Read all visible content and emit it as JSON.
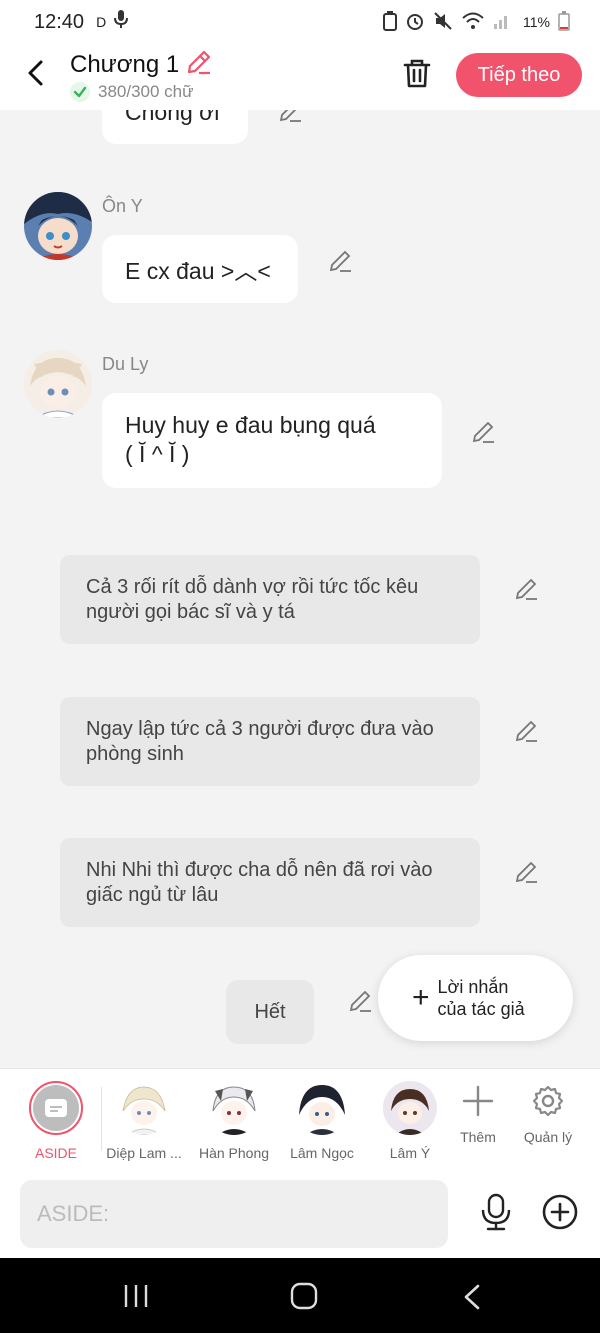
{
  "status_bar": {
    "time": "12:40",
    "d_label": "D",
    "battery": "11%"
  },
  "header": {
    "title": "Chương 1",
    "word_count": "380/300 chữ",
    "next_label": "Tiếp theo"
  },
  "messages": [
    {
      "name": "",
      "text": "Chồng ơi"
    },
    {
      "name": "Ôn Y",
      "text": "E cx đau >︿<"
    },
    {
      "name": "Du Ly",
      "line1": "Huy huy e đau bụng quá",
      "line2": "( Ĭ ^ Ĭ )"
    }
  ],
  "narrations": [
    {
      "line1": "Cả 3 rối rít dỗ dành vợ rồi tức tốc kêu",
      "line2": "người gọi bác sĩ và y tá"
    },
    {
      "line1": "Ngay lập tức cả 3 người được đưa vào",
      "line2": "phòng sinh"
    },
    {
      "line1": "Nhi Nhi thì được cha dỗ nên đã rơi vào",
      "line2": "giấc ngủ từ lâu"
    }
  ],
  "end_label": "Hết",
  "author_note": {
    "line1": "Lời nhắn",
    "line2": "của tác giả"
  },
  "characters": [
    {
      "label": "ASIDE"
    },
    {
      "label": "Diệp Lam ..."
    },
    {
      "label": "Hàn Phong"
    },
    {
      "label": "Lâm Ngọc"
    },
    {
      "label": "Lâm Ý"
    },
    {
      "label": "Thêm"
    },
    {
      "label": "Quản lý"
    }
  ],
  "input": {
    "placeholder": "ASIDE:"
  },
  "colors": {
    "accent": "#f0536b",
    "background": "#f3f3f3"
  }
}
